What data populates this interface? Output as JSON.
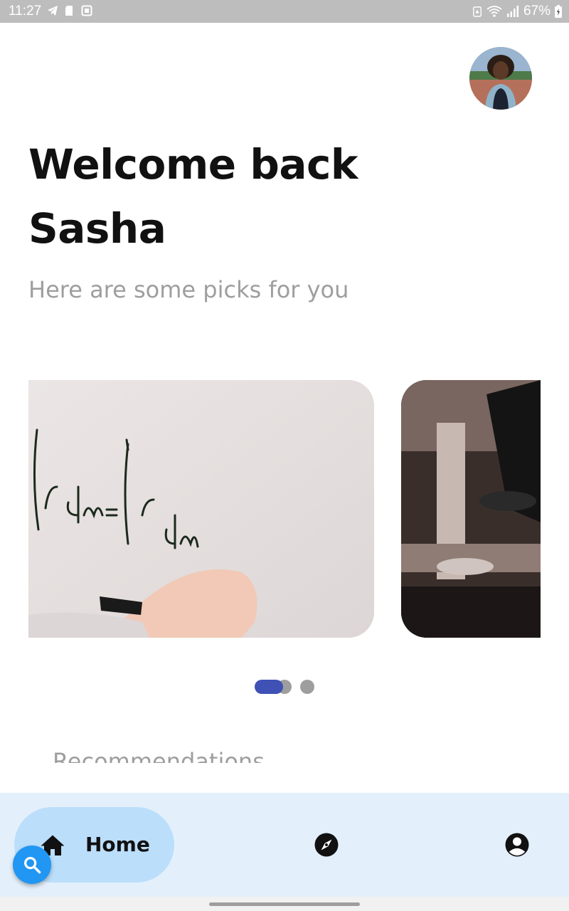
{
  "status_bar": {
    "time": "11:27",
    "battery_percent": "67%",
    "icons": [
      "telegram-icon",
      "sd-card-icon",
      "screenshot-icon",
      "data-saver-icon",
      "wifi-icon",
      "signal-icon",
      "battery-icon"
    ]
  },
  "header": {
    "welcome": "Welcome back Sasha",
    "subtitle": "Here are some picks for you"
  },
  "carousel": {
    "cards": [
      {
        "image": "whiteboard-math-equation"
      },
      {
        "image": "microscope-closeup"
      }
    ],
    "active_index": 0,
    "dot_count": 3
  },
  "section": {
    "title": "Recommendations"
  },
  "bottom_nav": {
    "items": [
      {
        "label": "Home",
        "icon": "home-icon",
        "active": true
      },
      {
        "label": "",
        "icon": "explore-icon",
        "active": false
      },
      {
        "label": "",
        "icon": "profile-icon",
        "active": false
      }
    ]
  },
  "fab": {
    "icon": "search-icon"
  },
  "colors": {
    "accent": "#3f51b5",
    "nav_background": "#e3f0fb",
    "nav_pill": "#bbdefb",
    "fab": "#2196f3",
    "muted_text": "#9e9e9e",
    "status_bar": "#bdbdbd"
  }
}
